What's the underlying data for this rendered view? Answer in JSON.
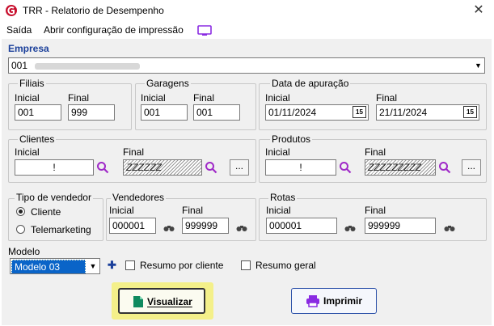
{
  "window": {
    "title": "TRR - Relatorio de Desempenho",
    "close": "✕"
  },
  "menu": {
    "exit": "Saída",
    "print_config": "Abrir configuração de impressão"
  },
  "empresa": {
    "label": "Empresa",
    "value": "001"
  },
  "filiais": {
    "label": "Filiais",
    "inicial_label": "Inicial",
    "final_label": "Final",
    "inicial": "001",
    "final": "999"
  },
  "garagens": {
    "label": "Garagens",
    "inicial_label": "Inicial",
    "final_label": "Final",
    "inicial": "001",
    "final": "001"
  },
  "data_apuracao": {
    "label": "Data de apuração",
    "inicial_label": "Inicial",
    "final_label": "Final",
    "inicial": "01/11/2024",
    "final": "21/11/2024",
    "cal_icon": "15"
  },
  "clientes": {
    "label": "Clientes",
    "inicial_label": "Inicial",
    "final_label": "Final",
    "inicial": "!",
    "final": "ZZZZZZ",
    "more": "..."
  },
  "produtos": {
    "label": "Produtos",
    "inicial_label": "Inicial",
    "final_label": "Final",
    "inicial": "!",
    "final": "ZZZZZZZZZ",
    "more": "..."
  },
  "tipo_vendedor": {
    "label": "Tipo de vendedor",
    "options": [
      "Cliente",
      "Telemarketing"
    ],
    "selected": "Cliente"
  },
  "vendedores": {
    "label": "Vendedores",
    "inicial_label": "Inicial",
    "final_label": "Final",
    "inicial": "000001",
    "final": "999999"
  },
  "rotas": {
    "label": "Rotas",
    "inicial_label": "Inicial",
    "final_label": "Final",
    "inicial": "000001",
    "final": "999999"
  },
  "modelo": {
    "label": "Modelo",
    "value": "Modelo 03",
    "add": "✚"
  },
  "options": {
    "resumo_cliente": "Resumo por cliente",
    "resumo_geral": "Resumo geral"
  },
  "buttons": {
    "visualizar": "Visualizar",
    "imprimir": "Imprimir"
  },
  "colors": {
    "accent_blue": "#1a3f9a",
    "highlight_yellow": "#f4f08a",
    "logo_red": "#c8102e",
    "monitor_purple": "#8a2be2"
  }
}
